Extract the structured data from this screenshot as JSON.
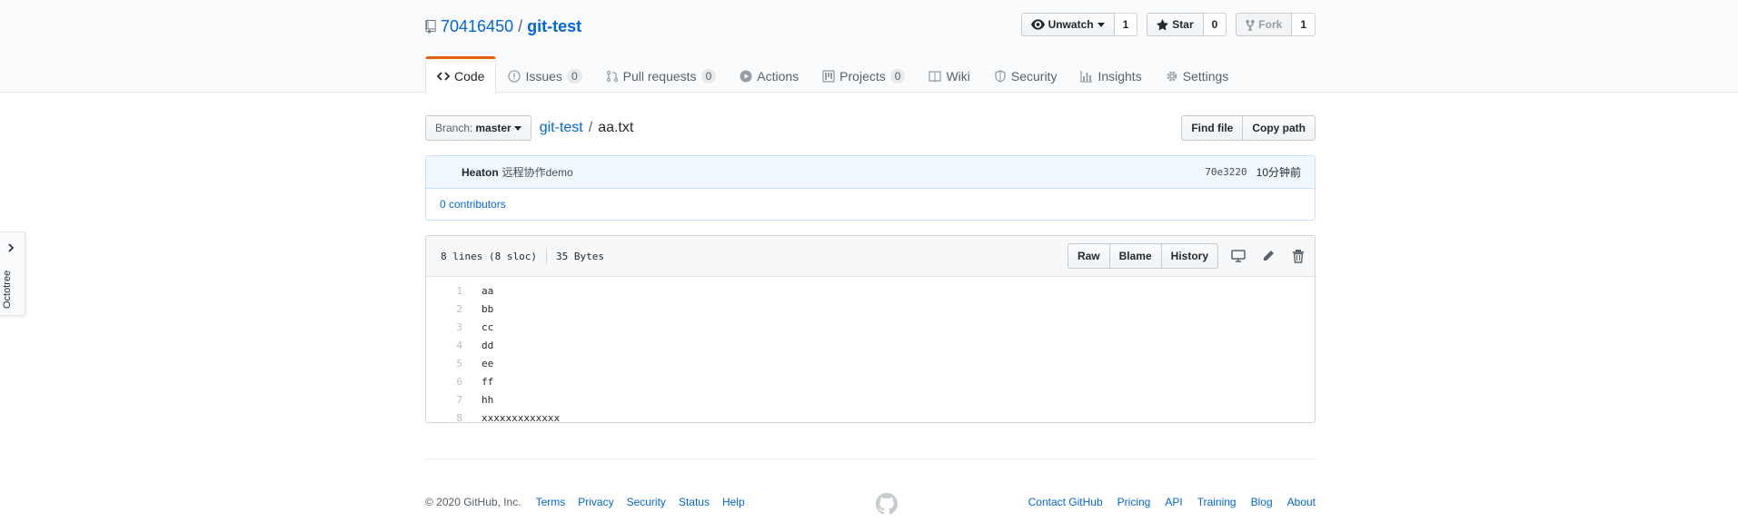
{
  "repo": {
    "owner": "70416450",
    "separator": "/",
    "name": "git-test",
    "watch_label": "Unwatch",
    "watch_count": "1",
    "star_label": "Star",
    "star_count": "0",
    "fork_label": "Fork",
    "fork_count": "1"
  },
  "nav": {
    "code": "Code",
    "issues": "Issues",
    "issues_count": "0",
    "pulls": "Pull requests",
    "pulls_count": "0",
    "actions": "Actions",
    "projects": "Projects",
    "projects_count": "0",
    "wiki": "Wiki",
    "security": "Security",
    "insights": "Insights",
    "settings": "Settings"
  },
  "file_nav": {
    "branch_label": "Branch:",
    "branch_name": "master",
    "repo_link": "git-test",
    "slash": "/",
    "file_name": "aa.txt",
    "find_file": "Find file",
    "copy_path": "Copy path"
  },
  "commit": {
    "author": "Heaton",
    "message": "远程协作demo",
    "sha": "70e3220",
    "time": "10分钟前",
    "contributors": "0 contributors"
  },
  "file": {
    "lines_info": "8 lines (8 sloc)",
    "size": "35 Bytes",
    "raw": "Raw",
    "blame": "Blame",
    "history": "History",
    "lines": [
      {
        "n": "1",
        "text": "aa"
      },
      {
        "n": "2",
        "text": "bb"
      },
      {
        "n": "3",
        "text": "cc"
      },
      {
        "n": "4",
        "text": "dd"
      },
      {
        "n": "5",
        "text": "ee"
      },
      {
        "n": "6",
        "text": "ff"
      },
      {
        "n": "7",
        "text": "hh"
      },
      {
        "n": "8",
        "text": "xxxxxxxxxxxxx"
      }
    ]
  },
  "footer": {
    "copyright": "© 2020 GitHub, Inc.",
    "left_links": [
      "Terms",
      "Privacy",
      "Security",
      "Status",
      "Help"
    ],
    "right_links": [
      "Contact GitHub",
      "Pricing",
      "API",
      "Training",
      "Blog",
      "About"
    ]
  },
  "octotree": {
    "label": "Octotree"
  },
  "colors": {
    "link": "#0366d6",
    "tab_accent": "#e36209",
    "commit_bg": "#f1f8ff"
  }
}
